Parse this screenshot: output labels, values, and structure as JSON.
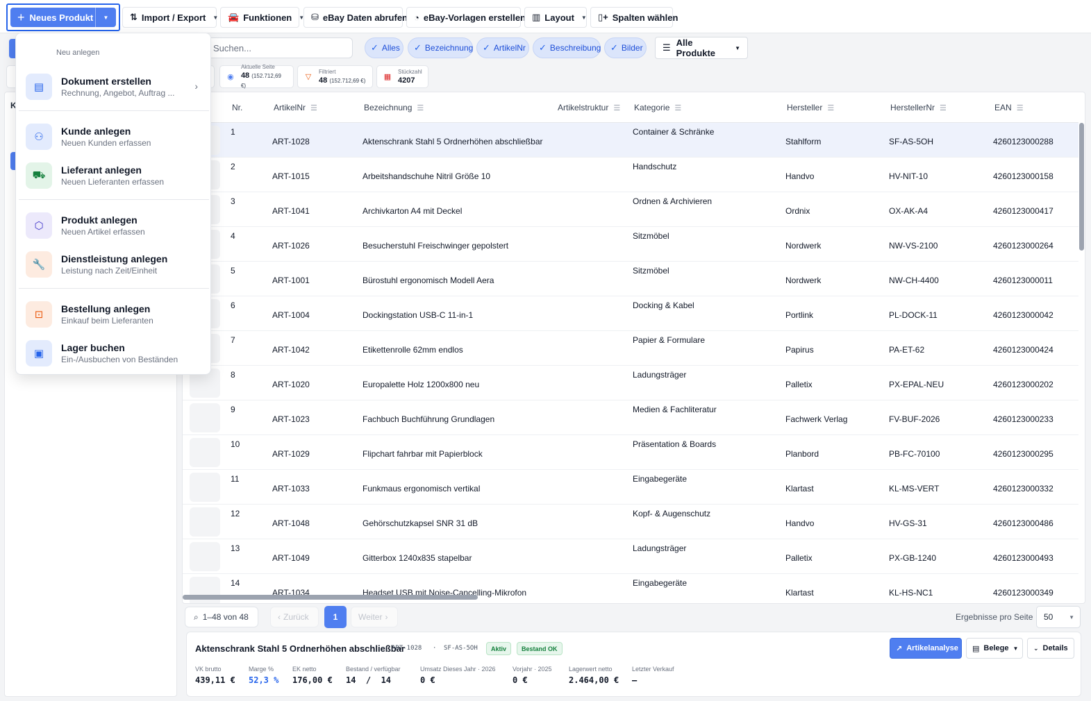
{
  "toolbar": {
    "new_product": "Neues Produkt",
    "import_export": "Import / Export",
    "functions": "Funktionen",
    "ebay_fetch": "eBay Daten abrufen",
    "ebay_templates": "eBay-Vorlagen erstellen",
    "layout": "Layout",
    "columns": "Spalten wählen"
  },
  "filter": {
    "search_placeholder": "Suchen...",
    "chips": [
      "Alles",
      "Bezeichnung",
      "ArtikelNr",
      "Beschreibung",
      "Bilder"
    ],
    "all_products": "Alle Produkte"
  },
  "stats": {
    "current_page_label": "Aktuelle Seite",
    "current_page_value": "48",
    "current_page_sum": "(152.712,69 €)",
    "filtered_label": "Filtriert",
    "filtered_value": "48",
    "filtered_sum": "(152.712,69 €)",
    "count_label": "Stückzahl",
    "count_value": "4207"
  },
  "left_panel": {
    "letter": "K"
  },
  "menu": {
    "header": "Neu anlegen",
    "items": [
      {
        "title": "Dokument erstellen",
        "sub": "Rechnung, Angebot, Auftrag ...",
        "icon": "document-icon"
      },
      {
        "title": "Kunde anlegen",
        "sub": "Neuen Kunden erfassen",
        "icon": "user-plus-icon"
      },
      {
        "title": "Lieferant anlegen",
        "sub": "Neuen Lieferanten erfassen",
        "icon": "truck-icon"
      },
      {
        "title": "Produkt anlegen",
        "sub": "Neuen Artikel erfassen",
        "icon": "box-icon"
      },
      {
        "title": "Dienstleistung anlegen",
        "sub": "Leistung nach Zeit/Einheit",
        "icon": "wrench-icon"
      },
      {
        "title": "Bestellung anlegen",
        "sub": "Einkauf beim Lieferanten",
        "icon": "shopping-bag-icon"
      },
      {
        "title": "Lager buchen",
        "sub": "Ein-/Ausbuchen von Beständen",
        "icon": "archive-icon"
      }
    ]
  },
  "table": {
    "headers": {
      "nr": "Nr.",
      "artnr": "ArtikelNr",
      "bez": "Bezeichnung",
      "struct": "Artikelstruktur",
      "kat": "Kategorie",
      "herst": "Hersteller",
      "herstnr": "HerstellerNr",
      "ean": "EAN"
    },
    "rows": [
      {
        "nr": "1",
        "artnr": "ART-1028",
        "bez": "Aktenschrank Stahl 5 Ordnerhöhen abschließbar",
        "kat": "Container & Schränke",
        "herst": "Stahlform",
        "herstnr": "SF-AS-5OH",
        "ean": "4260123000288"
      },
      {
        "nr": "2",
        "artnr": "ART-1015",
        "bez": "Arbeitshandschuhe Nitril Größe 10",
        "kat": "Handschutz",
        "herst": "Handvo",
        "herstnr": "HV-NIT-10",
        "ean": "4260123000158"
      },
      {
        "nr": "3",
        "artnr": "ART-1041",
        "bez": "Archivkarton A4 mit Deckel",
        "kat": "Ordnen & Archivieren",
        "herst": "Ordnix",
        "herstnr": "OX-AK-A4",
        "ean": "4260123000417"
      },
      {
        "nr": "4",
        "artnr": "ART-1026",
        "bez": "Besucherstuhl Freischwinger gepolstert",
        "kat": "Sitzmöbel",
        "herst": "Nordwerk",
        "herstnr": "NW-VS-2100",
        "ean": "4260123000264"
      },
      {
        "nr": "5",
        "artnr": "ART-1001",
        "bez": "Bürostuhl ergonomisch Modell Aera",
        "kat": "Sitzmöbel",
        "herst": "Nordwerk",
        "herstnr": "NW-CH-4400",
        "ean": "4260123000011"
      },
      {
        "nr": "6",
        "artnr": "ART-1004",
        "bez": "Dockingstation USB-C 11-in-1",
        "kat": "Docking & Kabel",
        "herst": "Portlink",
        "herstnr": "PL-DOCK-11",
        "ean": "4260123000042"
      },
      {
        "nr": "7",
        "artnr": "ART-1042",
        "bez": "Etikettenrolle 62mm endlos",
        "kat": "Papier & Formulare",
        "herst": "Papirus",
        "herstnr": "PA-ET-62",
        "ean": "4260123000424"
      },
      {
        "nr": "8",
        "artnr": "ART-1020",
        "bez": "Europalette Holz 1200x800 neu",
        "kat": "Ladungsträger",
        "herst": "Palletix",
        "herstnr": "PX-EPAL-NEU",
        "ean": "4260123000202"
      },
      {
        "nr": "9",
        "artnr": "ART-1023",
        "bez": "Fachbuch Buchführung Grundlagen",
        "kat": "Medien & Fachliteratur",
        "herst": "Fachwerk Verlag",
        "herstnr": "FV-BUF-2026",
        "ean": "4260123000233"
      },
      {
        "nr": "10",
        "artnr": "ART-1029",
        "bez": "Flipchart fahrbar mit Papierblock",
        "kat": "Präsentation & Boards",
        "herst": "Planbord",
        "herstnr": "PB-FC-70100",
        "ean": "4260123000295"
      },
      {
        "nr": "11",
        "artnr": "ART-1033",
        "bez": "Funkmaus ergonomisch vertikal",
        "kat": "Eingabegeräte",
        "herst": "Klartast",
        "herstnr": "KL-MS-VERT",
        "ean": "4260123000332"
      },
      {
        "nr": "12",
        "artnr": "ART-1048",
        "bez": "Gehörschutzkapsel SNR 31 dB",
        "kat": "Kopf- & Augenschutz",
        "herst": "Handvo",
        "herstnr": "HV-GS-31",
        "ean": "4260123000486"
      },
      {
        "nr": "13",
        "artnr": "ART-1049",
        "bez": "Gitterbox 1240x835 stapelbar",
        "kat": "Ladungsträger",
        "herst": "Palletix",
        "herstnr": "PX-GB-1240",
        "ean": "4260123000493"
      },
      {
        "nr": "14",
        "artnr": "ART-1034",
        "bez": "Headset USB mit Noise-Cancelling-Mikrofon",
        "kat": "Eingabegeräte",
        "herst": "Klartast",
        "herstnr": "KL-HS-NC1",
        "ean": "4260123000349"
      }
    ]
  },
  "pager": {
    "count": "1–48 von 48",
    "prev": "Zurück",
    "current": "1",
    "next": "Weiter",
    "per_page_label": "Ergebnisse pro Seite",
    "per_page": "50"
  },
  "detail": {
    "title": "Aktenschrank Stahl 5 Ordnerhöhen abschließbar",
    "artnr": "ART-1028",
    "dot": "·",
    "herstnr": "SF-AS-5OH",
    "badge_status": "Aktiv",
    "badge_stock": "Bestand OK",
    "btn_analysis": "Artikelanalyse",
    "btn_docs": "Belege",
    "btn_details": "Details",
    "stats": [
      {
        "label": "VK brutto",
        "value": "439,11 €"
      },
      {
        "label": "Marge %",
        "value": "52,3 %"
      },
      {
        "label": "EK netto",
        "value": "176,00 €"
      },
      {
        "label": "Bestand / verfügbar",
        "value": "14  /  14"
      },
      {
        "label": "Umsatz Dieses Jahr · 2026",
        "value": "0 €"
      },
      {
        "label": "Vorjahr · 2025",
        "value": "0 €"
      },
      {
        "label": "Lagerwert netto",
        "value": "2.464,00 €"
      },
      {
        "label": "Letzter Verkauf",
        "value": "—"
      }
    ]
  },
  "colors": {
    "primary": "#4f7ef0",
    "focus_ring": "#2563eb",
    "chip_bg": "#dbe5fb",
    "badge_green": "#15803d"
  }
}
